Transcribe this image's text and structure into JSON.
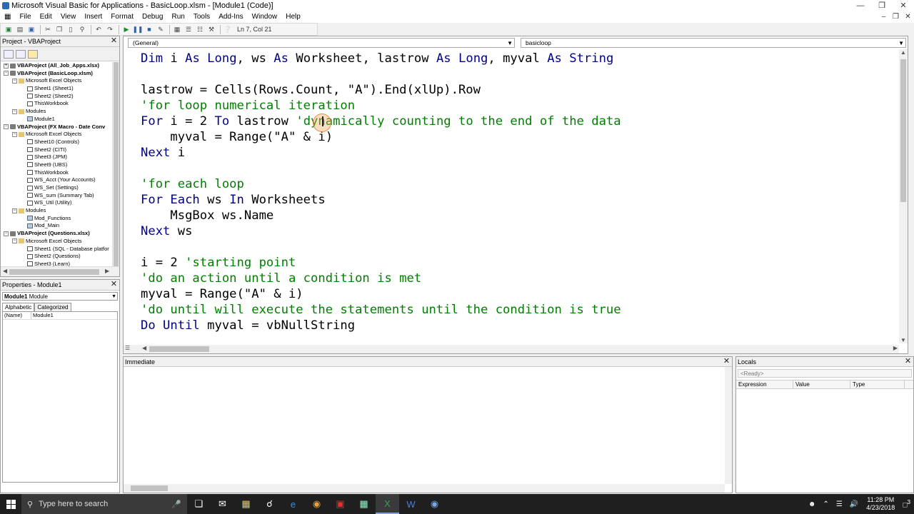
{
  "window": {
    "title": "Microsoft Visual Basic for Applications - BasicLoop.xlsm - [Module1 (Code)]"
  },
  "menu": [
    "File",
    "Edit",
    "View",
    "Insert",
    "Format",
    "Debug",
    "Run",
    "Tools",
    "Add-Ins",
    "Window",
    "Help"
  ],
  "toolbar": {
    "position": "Ln 7, Col 21"
  },
  "project": {
    "title": "Project - VBAProject",
    "tree": [
      {
        "label": "VBAProject (All_Job_Apps.xlsx)",
        "level": 0,
        "type": "proj",
        "bold": true,
        "exp": "+"
      },
      {
        "label": "VBAProject (BasicLoop.xlsm)",
        "level": 0,
        "type": "proj",
        "bold": true,
        "exp": "-"
      },
      {
        "label": "Microsoft Excel Objects",
        "level": 1,
        "type": "fold",
        "exp": "-"
      },
      {
        "label": "Sheet1 (Sheet1)",
        "level": 2,
        "type": "sheet"
      },
      {
        "label": "Sheet2 (Sheet2)",
        "level": 2,
        "type": "sheet"
      },
      {
        "label": "ThisWorkbook",
        "level": 2,
        "type": "sheet"
      },
      {
        "label": "Modules",
        "level": 1,
        "type": "fold",
        "exp": "-"
      },
      {
        "label": "Module1",
        "level": 2,
        "type": "mod"
      },
      {
        "label": "VBAProject (FX Macro - Date Conv",
        "level": 0,
        "type": "proj",
        "bold": true,
        "exp": "-"
      },
      {
        "label": "Microsoft Excel Objects",
        "level": 1,
        "type": "fold",
        "exp": "-"
      },
      {
        "label": "Sheet10 (Controls)",
        "level": 2,
        "type": "sheet"
      },
      {
        "label": "Sheet2 (CITI)",
        "level": 2,
        "type": "sheet"
      },
      {
        "label": "Sheet3 (JPM)",
        "level": 2,
        "type": "sheet"
      },
      {
        "label": "Sheet9 (UBS)",
        "level": 2,
        "type": "sheet"
      },
      {
        "label": "ThisWorkbook",
        "level": 2,
        "type": "sheet"
      },
      {
        "label": "WS_Acct (Your Accounts)",
        "level": 2,
        "type": "sheet"
      },
      {
        "label": "WS_Set (Settings)",
        "level": 2,
        "type": "sheet"
      },
      {
        "label": "WS_sum (Summary Tab)",
        "level": 2,
        "type": "sheet"
      },
      {
        "label": "WS_Util (Utility)",
        "level": 2,
        "type": "sheet"
      },
      {
        "label": "Modules",
        "level": 1,
        "type": "fold",
        "exp": "-"
      },
      {
        "label": "Mod_Functions",
        "level": 2,
        "type": "mod"
      },
      {
        "label": "Mod_Main",
        "level": 2,
        "type": "mod"
      },
      {
        "label": "VBAProject (Questions.xlsx)",
        "level": 0,
        "type": "proj",
        "bold": true,
        "exp": "-"
      },
      {
        "label": "Microsoft Excel Objects",
        "level": 1,
        "type": "fold",
        "exp": "-"
      },
      {
        "label": "Sheet1 (SQL - Database platfor",
        "level": 2,
        "type": "sheet"
      },
      {
        "label": "Sheet2 (Questions)",
        "level": 2,
        "type": "sheet"
      },
      {
        "label": "Sheet3 (Learn)",
        "level": 2,
        "type": "sheet"
      }
    ]
  },
  "properties": {
    "title": "Properties - Module1",
    "object_name": "Module1",
    "object_type": "Module",
    "tabs": [
      "Alphabetic",
      "Categorized"
    ],
    "rows": [
      {
        "name": "(Name)",
        "value": "Module1"
      }
    ]
  },
  "code": {
    "object_combo": "(General)",
    "proc_combo": "basicloop",
    "lines": [
      [
        [
          "Dim ",
          "kw"
        ],
        [
          "i ",
          ""
        ],
        [
          "As Long",
          "kw"
        ],
        [
          ", ws ",
          ""
        ],
        [
          "As ",
          "kw"
        ],
        [
          "Worksheet, lastrow ",
          ""
        ],
        [
          "As Long",
          "kw"
        ],
        [
          ", myval ",
          ""
        ],
        [
          "As String",
          "kw"
        ]
      ],
      [],
      [
        [
          "lastrow = Cells(Rows.Count, \"A\").End(xlUp).Row",
          ""
        ]
      ],
      [
        [
          "'for loop numerical iteration",
          "cm"
        ]
      ],
      [
        [
          "For ",
          "kw"
        ],
        [
          "i = 2 ",
          ""
        ],
        [
          "To ",
          "kw"
        ],
        [
          "lastrow ",
          ""
        ],
        [
          "'dynamically counting to the end of the data",
          "cm"
        ]
      ],
      [
        [
          "    myval = Range(\"A\" & i)",
          ""
        ]
      ],
      [
        [
          "Next ",
          "kw"
        ],
        [
          "i",
          ""
        ]
      ],
      [],
      [
        [
          "'for each loop",
          "cm"
        ]
      ],
      [
        [
          "For Each ",
          "kw"
        ],
        [
          "ws ",
          ""
        ],
        [
          "In ",
          "kw"
        ],
        [
          "Worksheets",
          ""
        ]
      ],
      [
        [
          "    MsgBox ws.Name",
          ""
        ]
      ],
      [
        [
          "Next ",
          "kw"
        ],
        [
          "ws",
          ""
        ]
      ],
      [],
      [
        [
          "i = 2 ",
          ""
        ],
        [
          "'starting point",
          "cm"
        ]
      ],
      [
        [
          "'do an action until a condition is met",
          "cm"
        ]
      ],
      [
        [
          "myval = Range(\"A\" & i)",
          ""
        ]
      ],
      [
        [
          "'do until will execute the statements until the condition is true",
          "cm"
        ]
      ],
      [
        [
          "Do Until ",
          "kw"
        ],
        [
          "myval = vbNullString",
          ""
        ]
      ]
    ]
  },
  "immediate": {
    "title": "Immediate"
  },
  "locals": {
    "title": "Locals",
    "ready": "<Ready>",
    "columns": [
      "Expression",
      "Value",
      "Type"
    ]
  },
  "taskbar": {
    "search_placeholder": "Type here to search",
    "time": "11:28 PM",
    "date": "4/23/2018",
    "notifications": "3"
  },
  "colors": {
    "keyword": "#00008b",
    "comment": "#008000",
    "taskbar": "#1f1f1f"
  }
}
